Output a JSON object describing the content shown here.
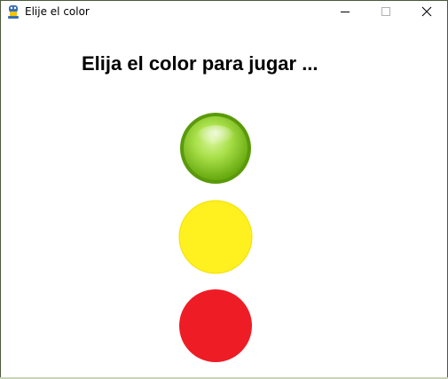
{
  "window": {
    "title": "Elije el color",
    "icon": "snake-app-icon",
    "controls": [
      "minimize",
      "maximize",
      "close"
    ]
  },
  "main": {
    "heading": "Elija el color para jugar ...",
    "options": [
      {
        "name": "green",
        "color": "#7cc417"
      },
      {
        "name": "yellow",
        "color": "#fff01f"
      },
      {
        "name": "red",
        "color": "#ee1c25"
      }
    ]
  }
}
